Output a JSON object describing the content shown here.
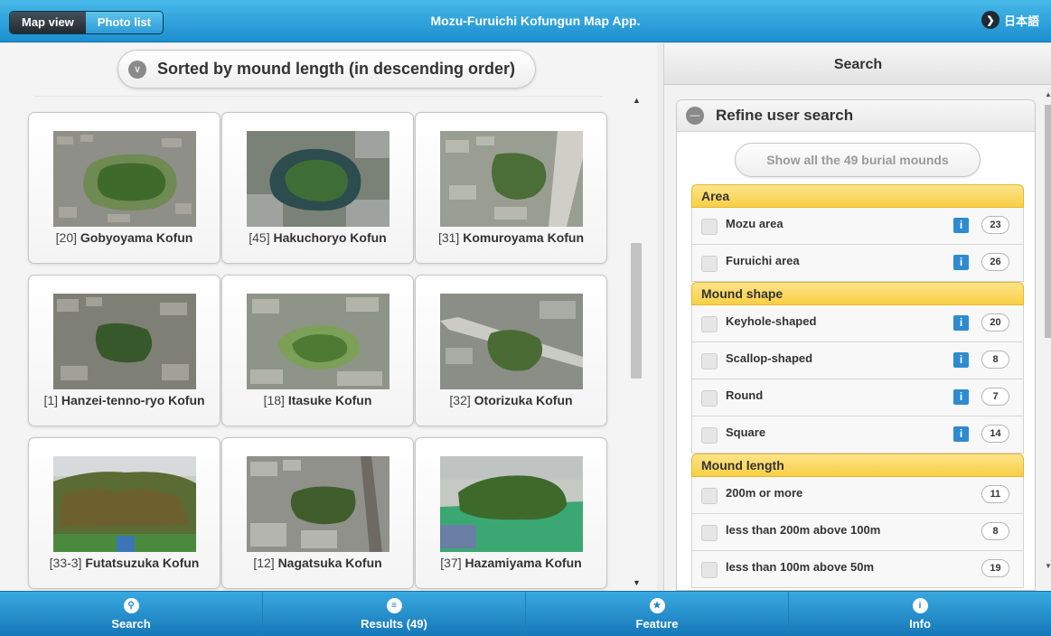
{
  "header": {
    "tabs": [
      {
        "label": "Map view",
        "active": true
      },
      {
        "label": "Photo list",
        "active": false
      }
    ],
    "title": "Mozu-Furuichi Kofungun Map App.",
    "language_label": "日本語",
    "language_icon": "chevron-right-icon",
    "accent_color": "#1c8fcf"
  },
  "photo_list": {
    "sort_label": "Sorted by mound length (in descending order)",
    "sort_icon": "chevron-down-icon",
    "items": [
      {
        "id": "[20]",
        "name": "Gobyoyama Kofun"
      },
      {
        "id": "[45]",
        "name": "Hakuchoryo Kofun"
      },
      {
        "id": "[31]",
        "name": "Komuroyama Kofun"
      },
      {
        "id": "[1]",
        "name": "Hanzei-tenno-ryo Kofun"
      },
      {
        "id": "[18]",
        "name": "Itasuke Kofun"
      },
      {
        "id": "[32]",
        "name": "Otorizuka Kofun"
      },
      {
        "id": "[33-3]",
        "name": "Futatsuzuka Kofun"
      },
      {
        "id": "[12]",
        "name": "Nagatsuka Kofun"
      },
      {
        "id": "[37]",
        "name": "Hazamiyama Kofun"
      }
    ]
  },
  "search_panel": {
    "title": "Search",
    "section_title": "Refine user search",
    "section_icon": "minus-circle-icon",
    "show_all_label": "Show all the 49 burial mounds",
    "groups": [
      {
        "label": "Area",
        "options": [
          {
            "label": "Mozu area",
            "count": "23",
            "info": true
          },
          {
            "label": "Furuichi area",
            "count": "26",
            "info": true
          }
        ]
      },
      {
        "label": "Mound shape",
        "options": [
          {
            "label": "Keyhole-shaped",
            "count": "20",
            "info": true
          },
          {
            "label": "Scallop-shaped",
            "count": "8",
            "info": true
          },
          {
            "label": "Round",
            "count": "7",
            "info": true
          },
          {
            "label": "Square",
            "count": "14",
            "info": true
          }
        ]
      },
      {
        "label": "Mound length",
        "options": [
          {
            "label": "200m or more",
            "count": "11",
            "info": false
          },
          {
            "label": "less than 200m above 100m",
            "count": "8",
            "info": false
          },
          {
            "label": "less than 100m above 50m",
            "count": "19",
            "info": false
          }
        ]
      }
    ],
    "group_color": "#f8cf45",
    "info_color": "#2e8bd0"
  },
  "footer": {
    "tabs": [
      {
        "label": "Search",
        "icon": "search-icon"
      },
      {
        "label": "Results (49)",
        "icon": "list-icon"
      },
      {
        "label": "Feature",
        "icon": "star-icon"
      },
      {
        "label": "Info",
        "icon": "info-icon"
      }
    ]
  }
}
